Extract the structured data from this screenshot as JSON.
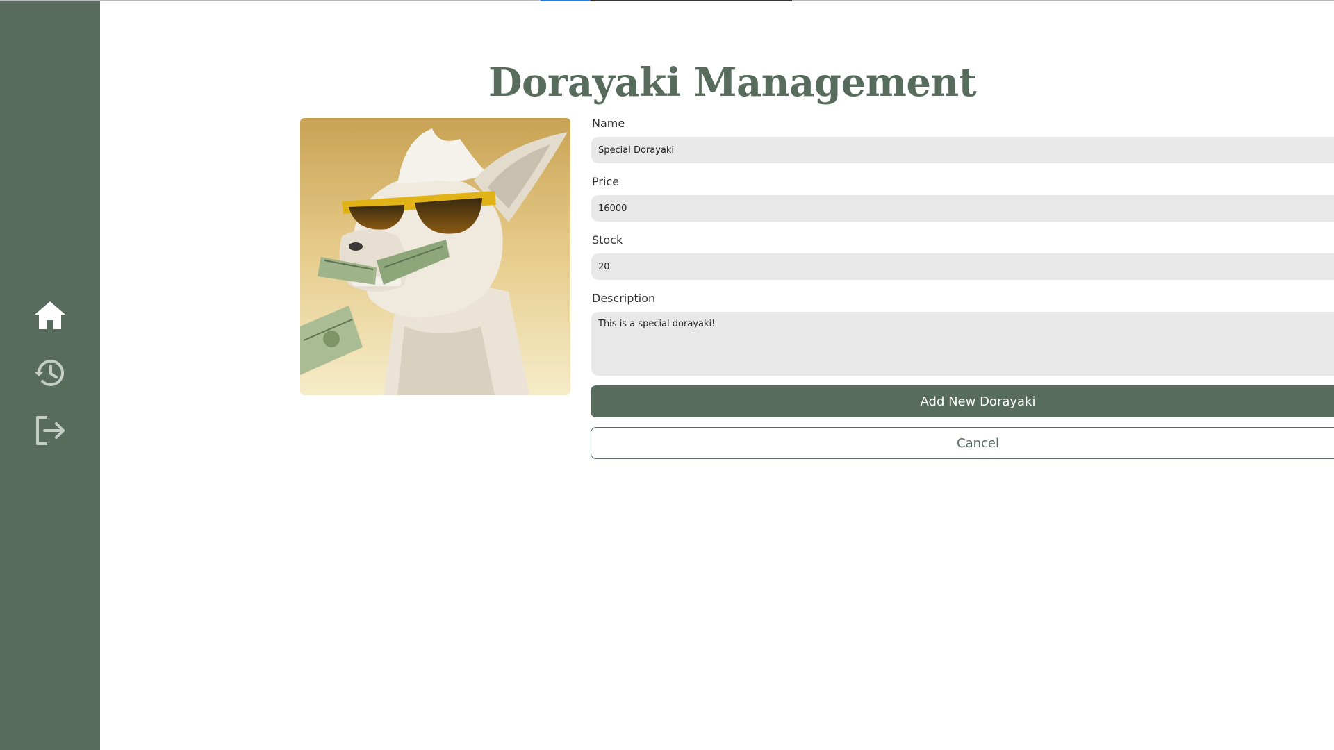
{
  "page": {
    "title": "Dorayaki Management"
  },
  "sidebar": {
    "items": [
      {
        "icon": "home-icon",
        "active": true
      },
      {
        "icon": "history-icon",
        "active": false
      },
      {
        "icon": "logout-icon",
        "active": false
      }
    ],
    "colors": {
      "background": "#576c5d",
      "active_icon": "#ffffff",
      "inactive_icon": "#c4cdc6"
    }
  },
  "form": {
    "name": {
      "label": "Name",
      "value": "Special Dorayaki"
    },
    "price": {
      "label": "Price",
      "value": "16000"
    },
    "stock": {
      "label": "Stock",
      "value": "20"
    },
    "description": {
      "label": "Description",
      "value": "This is a special dorayaki!"
    },
    "submit_label": "Add New Dorayaki",
    "cancel_label": "Cancel"
  },
  "image": {
    "subject": "llama-wearing-sunglasses-with-money"
  },
  "colors": {
    "accent": "#576c5d",
    "input_bg": "#e8e8e8"
  }
}
